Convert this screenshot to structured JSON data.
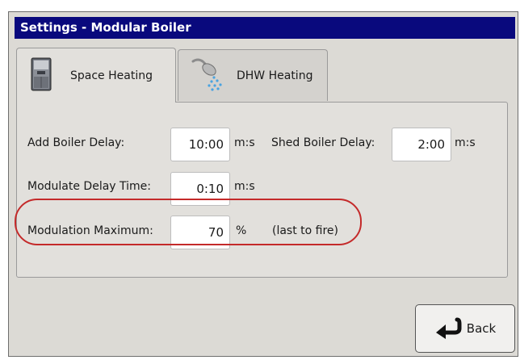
{
  "window": {
    "title": "Settings - Modular Boiler"
  },
  "tabs": [
    {
      "label": "Space Heating",
      "icon": "boiler-icon",
      "active": true
    },
    {
      "label": "DHW Heating",
      "icon": "shower-icon",
      "active": false
    }
  ],
  "fields": {
    "add_boiler_delay": {
      "label": "Add Boiler Delay:",
      "value": "10:00",
      "unit": "m:s"
    },
    "shed_boiler_delay": {
      "label": "Shed Boiler Delay:",
      "value": "2:00",
      "unit": "m:s"
    },
    "modulate_delay_time": {
      "label": "Modulate Delay Time:",
      "value": "0:10",
      "unit": "m:s"
    },
    "modulation_maximum": {
      "label": "Modulation Maximum:",
      "value": "70",
      "unit": "%",
      "note": "(last to fire)"
    }
  },
  "buttons": {
    "back_label": "Back",
    "back_icon": "return-arrow-icon"
  },
  "colors": {
    "titlebar": "#09097d",
    "highlight": "#c42a2a"
  }
}
